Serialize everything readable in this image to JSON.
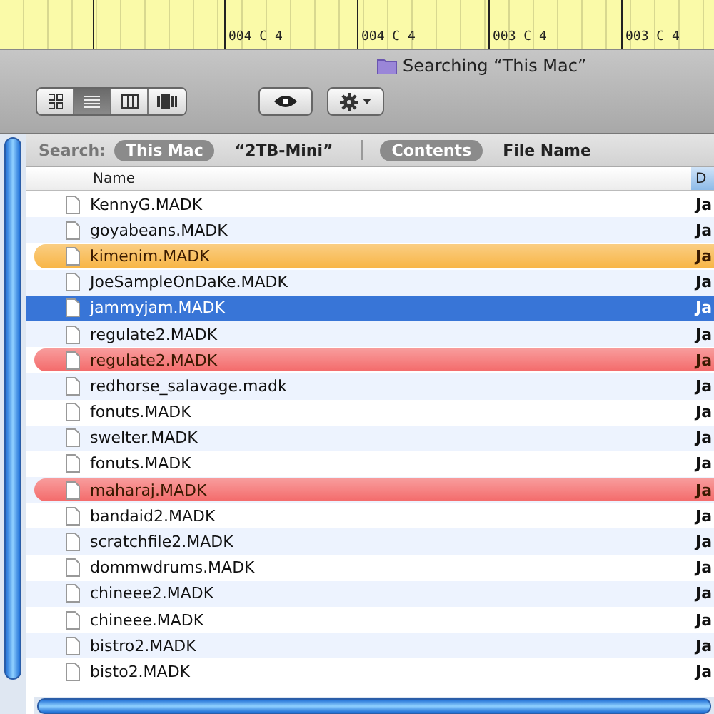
{
  "ruler": {
    "labels": [
      "004 C 4",
      "004 C 4",
      "003 C 4",
      "003 C 4"
    ]
  },
  "window": {
    "title": "Searching “This Mac”"
  },
  "toolbar": {
    "views": [
      {
        "kind": "icons",
        "selected": false
      },
      {
        "kind": "list",
        "selected": true
      },
      {
        "kind": "columns",
        "selected": false
      },
      {
        "kind": "coverflow",
        "selected": false
      }
    ]
  },
  "search_bar": {
    "label": "Search:",
    "scopes": [
      {
        "label": "This Mac",
        "selected": true
      },
      {
        "label": "“2TB-Mini”",
        "selected": false
      }
    ],
    "fields": [
      {
        "label": "Contents",
        "selected": true
      },
      {
        "label": "File Name",
        "selected": false
      }
    ]
  },
  "table": {
    "columns": [
      "Name",
      "D"
    ],
    "rows": [
      {
        "name": "KennyG.MADK",
        "date": "Ja",
        "selected": false
      },
      {
        "name": "goyabeans.MADK",
        "date": "Ja",
        "selected": false
      },
      {
        "name": "kimenim.MADK",
        "date": "Ja",
        "selected": false,
        "color": "#f8b545"
      },
      {
        "name": "JoeSampleOnDaKe.MADK",
        "date": "Ja",
        "selected": false
      },
      {
        "name": "jammyjam.MADK",
        "date": "Ja",
        "selected": true
      },
      {
        "name": "regulate2.MADK",
        "date": "Ja",
        "selected": false
      },
      {
        "name": "regulate2.MADK",
        "date": "Ja",
        "selected": false,
        "color": "#f46b6b"
      },
      {
        "name": "redhorse_salavage.madk",
        "date": "Ja",
        "selected": false
      },
      {
        "name": "fonuts.MADK",
        "date": "Ja",
        "selected": false
      },
      {
        "name": "swelter.MADK",
        "date": "Ja",
        "selected": false
      },
      {
        "name": "fonuts.MADK",
        "date": "Ja",
        "selected": false
      },
      {
        "name": "maharaj.MADK",
        "date": "Ja",
        "selected": false,
        "color": "#f46b6b"
      },
      {
        "name": "bandaid2.MADK",
        "date": "Ja",
        "selected": false
      },
      {
        "name": "scratchfile2.MADK",
        "date": "Ja",
        "selected": false
      },
      {
        "name": "dommwdrums.MADK",
        "date": "Ja",
        "selected": false
      },
      {
        "name": "chineee2.MADK",
        "date": "Ja",
        "selected": false
      },
      {
        "name": "chineee.MADK",
        "date": "Ja",
        "selected": false
      },
      {
        "name": "bistro2.MADK",
        "date": "Ja",
        "selected": false
      },
      {
        "name": "bisto2.MADK",
        "date": "Ja",
        "selected": false
      }
    ]
  }
}
